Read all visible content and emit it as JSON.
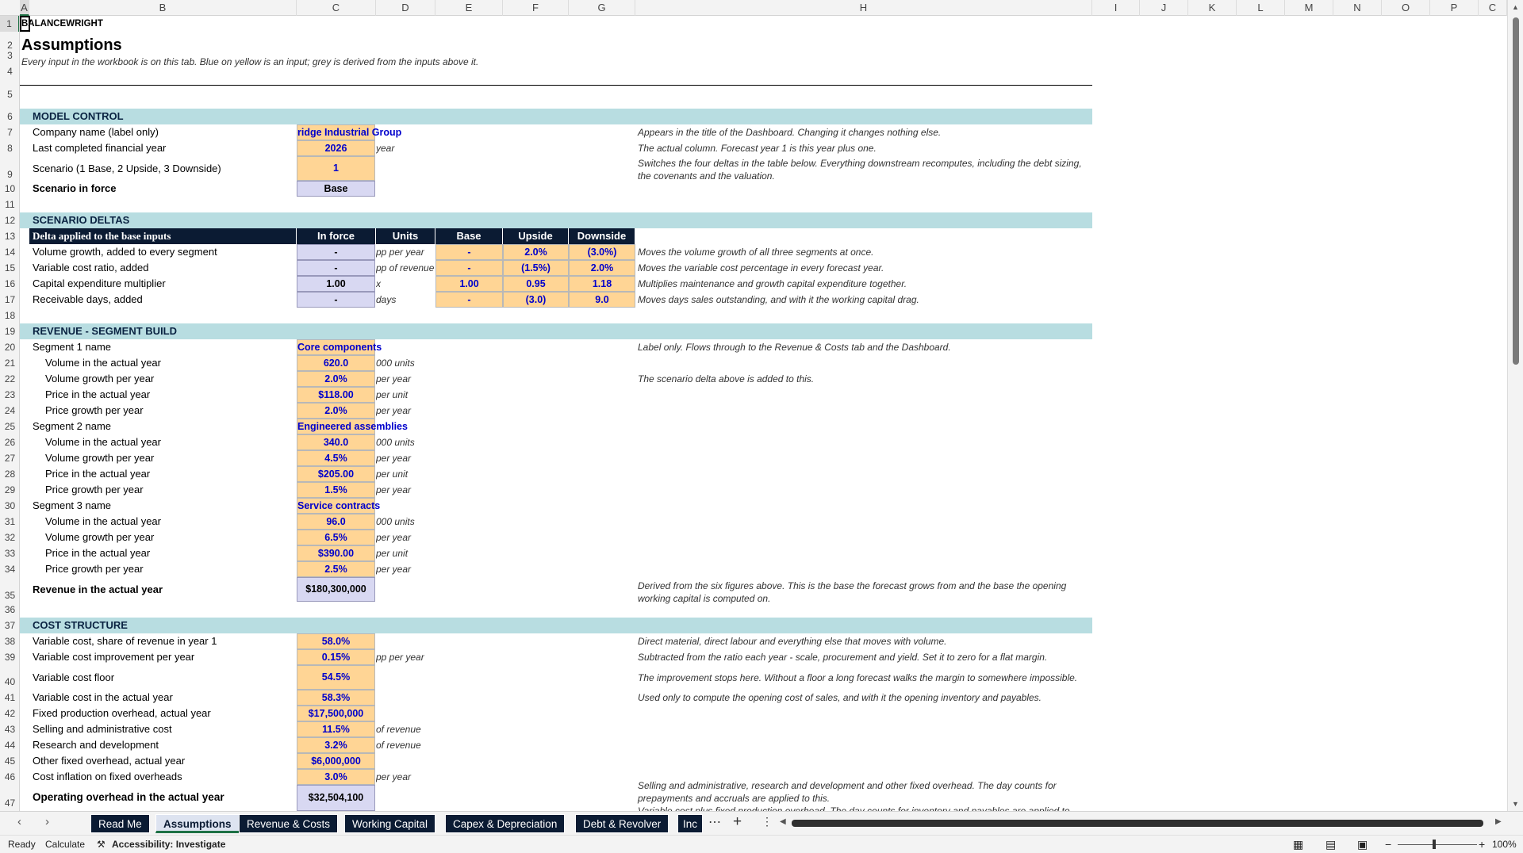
{
  "columns": [
    "A",
    "B",
    "C",
    "D",
    "E",
    "F",
    "G",
    "H",
    "I",
    "J",
    "K",
    "L",
    "M",
    "N",
    "O",
    "P",
    "C"
  ],
  "rows": [
    "1",
    "2",
    "3",
    "4",
    "5",
    "6",
    "7",
    "8",
    "9",
    "10",
    "11",
    "12",
    "13",
    "14",
    "15",
    "16",
    "17",
    "18",
    "19",
    "20",
    "21",
    "22",
    "23",
    "24",
    "25",
    "26",
    "27",
    "28",
    "29",
    "30",
    "31",
    "32",
    "33",
    "34",
    "35",
    "36",
    "37",
    "38",
    "39",
    "40",
    "41",
    "42",
    "43",
    "44",
    "45",
    "46",
    "47"
  ],
  "brand": "BALANCEWRIGHT",
  "title": "Assumptions",
  "subtitle": "Every input in the workbook is on this tab. Blue on yellow is an input; grey is derived from the inputs above it.",
  "model_control": {
    "header": "MODEL CONTROL",
    "company_label": "Company name (label only)",
    "company_value": "ridge Industrial Group",
    "company_note": "Appears in the title of the Dashboard. Changing it changes nothing else.",
    "year_label": "Last completed financial year",
    "year_value": "2026",
    "year_unit": "year",
    "year_note": "The actual column. Forecast year 1 is this year plus one.",
    "scenario_label": "Scenario (1 Base, 2 Upside, 3 Downside)",
    "scenario_value": "1",
    "scenario_note": "Switches the four deltas in the table below. Everything downstream recomputes, including the debt sizing, the covenants and the valuation.",
    "inforce_label": "Scenario in force",
    "inforce_value": "Base"
  },
  "scenario_deltas": {
    "header": "SCENARIO DELTAS",
    "col_headers": [
      "Delta applied to the base inputs",
      "In force",
      "Units",
      "Base",
      "Upside",
      "Downside"
    ],
    "rows": [
      {
        "label": "Volume growth, added to every segment",
        "inforce": "-",
        "units": "pp per year",
        "base": "-",
        "upside": "2.0%",
        "downside": "(3.0%)",
        "note": "Moves the volume growth of all three segments at once."
      },
      {
        "label": "Variable cost ratio, added",
        "inforce": "-",
        "units": "pp of revenue",
        "base": "-",
        "upside": "(1.5%)",
        "downside": "2.0%",
        "note": "Moves the variable cost percentage in every forecast year."
      },
      {
        "label": "Capital expenditure multiplier",
        "inforce": "1.00",
        "units": "x",
        "base": "1.00",
        "upside": "0.95",
        "downside": "1.18",
        "note": "Multiplies maintenance and growth capital expenditure together."
      },
      {
        "label": "Receivable days, added",
        "inforce": "-",
        "units": "days",
        "base": "-",
        "upside": "(3.0)",
        "downside": "9.0",
        "note": "Moves days sales outstanding, and with it the working capital drag."
      }
    ]
  },
  "revenue": {
    "header": "REVENUE - SEGMENT BUILD",
    "seg1_label": "Segment 1 name",
    "seg1_name": "Core components",
    "seg1_note": "Label only. Flows through to the Revenue & Costs tab and the Dashboard.",
    "seg1_vol_label": "Volume in the actual year",
    "seg1_vol": "620.0",
    "seg1_vol_unit": "000 units",
    "seg1_vg_label": "Volume growth per year",
    "seg1_vg": "2.0%",
    "seg1_vg_unit": "per year",
    "seg1_vg_note": "The scenario delta above is added to this.",
    "seg1_price_label": "Price in the actual year",
    "seg1_price": "$118.00",
    "seg1_price_unit": "per unit",
    "seg1_pg_label": "Price growth per year",
    "seg1_pg": "2.0%",
    "seg1_pg_unit": "per year",
    "seg2_label": "Segment 2 name",
    "seg2_name": "Engineered assemblies",
    "seg2_vol_label": "Volume in the actual year",
    "seg2_vol": "340.0",
    "seg2_vol_unit": "000 units",
    "seg2_vg_label": "Volume growth per year",
    "seg2_vg": "4.5%",
    "seg2_vg_unit": "per year",
    "seg2_price_label": "Price in the actual year",
    "seg2_price": "$205.00",
    "seg2_price_unit": "per unit",
    "seg2_pg_label": "Price growth per year",
    "seg2_pg": "1.5%",
    "seg2_pg_unit": "per year",
    "seg3_label": "Segment 3 name",
    "seg3_name": "Service contracts",
    "seg3_vol_label": "Volume in the actual year",
    "seg3_vol": "96.0",
    "seg3_vol_unit": "000 units",
    "seg3_vg_label": "Volume growth per year",
    "seg3_vg": "6.5%",
    "seg3_vg_unit": "per year",
    "seg3_price_label": "Price in the actual year",
    "seg3_price": "$390.00",
    "seg3_price_unit": "per unit",
    "seg3_pg_label": "Price growth per year",
    "seg3_pg": "2.5%",
    "seg3_pg_unit": "per year",
    "total_label": "Revenue in the actual year",
    "total_value": "$180,300,000",
    "total_note": "Derived from the six figures above. This is the base the forecast grows from and the base the opening working capital is computed on."
  },
  "costs": {
    "header": "COST STRUCTURE",
    "vc_label": "Variable cost, share of revenue in year 1",
    "vc": "58.0%",
    "vc_note": "Direct material, direct labour and everything else that moves with volume.",
    "vci_label": "Variable cost improvement per year",
    "vci": "0.15%",
    "vci_unit": "pp per year",
    "vci_note": "Subtracted from the ratio each year - scale, procurement and yield. Set it to zero for a flat margin.",
    "vcf_label": "Variable cost floor",
    "vcf": "54.5%",
    "vcf_note": "The improvement stops here. Without a floor a long forecast walks the margin to somewhere impossible.",
    "vca_label": "Variable cost in the actual year",
    "vca": "58.3%",
    "vca_note": "Used only to compute the opening cost of sales, and with it the opening inventory and payables.",
    "fpo_label": "Fixed production overhead, actual year",
    "fpo": "$17,500,000",
    "sga_label": "Selling and administrative cost",
    "sga": "11.5%",
    "sga_unit": "of revenue",
    "rd_label": "Research and development",
    "rd": "3.2%",
    "rd_unit": "of revenue",
    "ofo_label": "Other fixed overhead, actual year",
    "ofo": "$6,000,000",
    "inf_label": "Cost inflation on fixed overheads",
    "inf": "3.0%",
    "inf_unit": "per year",
    "opx_label": "Operating overhead in the actual year",
    "opx": "$32,504,100",
    "opx_note": "Selling and administrative, research and development and other fixed overhead. The day counts for prepayments and accruals are applied to this.",
    "opx_note2": "Variable cost plus fixed production overhead. The day counts for inventory and payables are applied to"
  },
  "tabs": [
    "Read Me",
    "Assumptions",
    "Revenue & Costs",
    "Working Capital",
    "Capex & Depreciation",
    "Debt & Revolver",
    "Inc"
  ],
  "active_tab": "Assumptions",
  "status": {
    "ready": "Ready",
    "calculate": "Calculate",
    "accessibility": "Accessibility: Investigate",
    "zoom": "100%"
  }
}
